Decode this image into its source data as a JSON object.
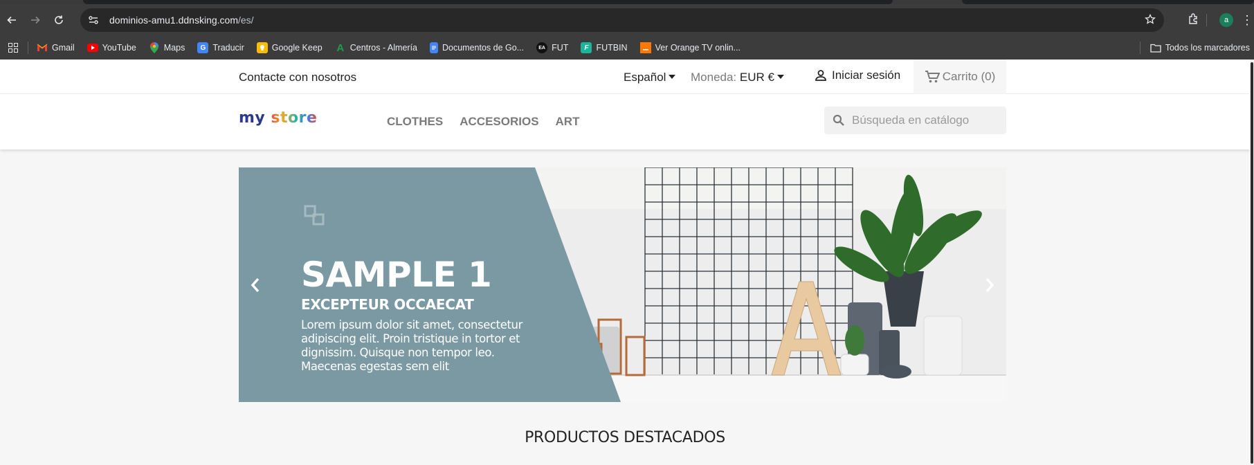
{
  "browser": {
    "url_host": "dominios-amu1.ddnsking.com",
    "url_path": "/es/",
    "profile_initial": "a",
    "bookmarks": [
      {
        "label": "Gmail",
        "icon": "gmail-icon"
      },
      {
        "label": "YouTube",
        "icon": "youtube-icon"
      },
      {
        "label": "Maps",
        "icon": "maps-icon"
      },
      {
        "label": "Traducir",
        "icon": "translate-icon"
      },
      {
        "label": "Google Keep",
        "icon": "keep-icon"
      },
      {
        "label": "Centros - Almería",
        "icon": "centros-icon"
      },
      {
        "label": "Documentos de Go...",
        "icon": "docs-icon"
      },
      {
        "label": "FUT",
        "icon": "ea-icon"
      },
      {
        "label": "FUTBIN",
        "icon": "futbin-icon"
      },
      {
        "label": "Ver Orange TV onlin...",
        "icon": "orange-icon"
      }
    ],
    "all_bookmarks": "Todos los marcadores"
  },
  "header": {
    "contact": "Contacte con nosotros",
    "language": "Español",
    "currency_label": "Moneda:",
    "currency_value": "EUR €",
    "signin": "Iniciar sesión",
    "cart": "Carrito (0)"
  },
  "nav": {
    "logo_my": "my",
    "logo_store": "store",
    "menu": [
      "CLOTHES",
      "ACCESORIOS",
      "ART"
    ],
    "search_placeholder": "Búsqueda en catálogo"
  },
  "slider": {
    "title": "SAMPLE 1",
    "subtitle": "EXCEPTEUR OCCAECAT",
    "text": "Lorem ipsum dolor sit amet, consectetur adipiscing elit. Proin tristique in tortor et dignissim. Quisque non tempor leo. Maecenas egestas sem elit",
    "panel_color": "#7a99a3"
  },
  "section": {
    "featured": "PRODUCTOS DESTACADOS"
  }
}
